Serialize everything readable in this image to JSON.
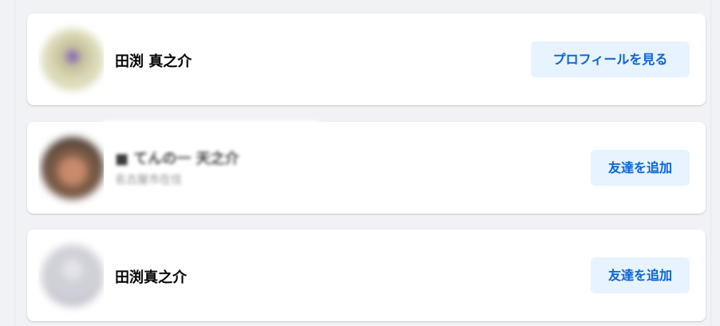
{
  "people": [
    {
      "name": "田渕 真之介",
      "subtitle": "",
      "action_label": "プロフィールを見る"
    },
    {
      "name": "■ てんの一 天之介",
      "subtitle": "名古屋市在住",
      "action_label": "友達を追加"
    },
    {
      "name": "田渕真之介",
      "subtitle": "",
      "action_label": "友達を追加"
    }
  ],
  "colors": {
    "page_background": "#f0f2f5",
    "card_background": "#ffffff",
    "button_background": "#e7f3ff",
    "button_text": "#0a64d2",
    "name_text": "#050505"
  }
}
